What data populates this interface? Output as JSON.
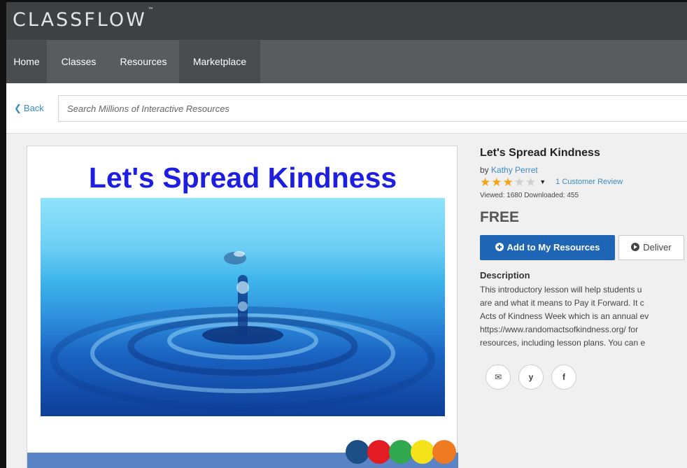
{
  "header": {
    "logo": "CLASSFLOW",
    "logo_mark": "™"
  },
  "nav": [
    {
      "label": "Home"
    },
    {
      "label": "Classes"
    },
    {
      "label": "Resources"
    },
    {
      "label": "Marketplace"
    }
  ],
  "search": {
    "back_label": "Back",
    "placeholder": "Search Millions of Interactive Resources"
  },
  "preview": {
    "title": "Let's Spread Kindness",
    "dot_colors": [
      "#1c4f86",
      "#e31b23",
      "#2fa84f",
      "#f4e21b",
      "#f07a22"
    ]
  },
  "resource": {
    "title": "Let's Spread Kindness",
    "by": "by",
    "author": "Kathy Perret",
    "rating": 3,
    "rating_max": 5,
    "reviews": "1 Customer Review",
    "stats": "Viewed: 1680  Downloaded: 455",
    "price": "FREE",
    "add_label": "Add to My Resources",
    "deliver_label": "Deliver",
    "description_heading": "Description",
    "description_lines": [
      "This introductory lesson will help students u",
      "are and what it means to Pay it Forward. It c",
      "Acts of Kindness Week which is an annual ev",
      "https://www.randomactsofkindness.org/ for",
      "resources, including lesson plans. You can e"
    ]
  },
  "share": [
    {
      "icon": "mail-icon",
      "glyph": "✉"
    },
    {
      "icon": "twitter-icon",
      "glyph": "y"
    },
    {
      "icon": "facebook-icon",
      "glyph": "f"
    }
  ],
  "colors": {
    "brand_blue": "#1e65b5",
    "link": "#3a8cc5",
    "star": "#f2a51a",
    "title_blue": "#1d1ee0"
  }
}
